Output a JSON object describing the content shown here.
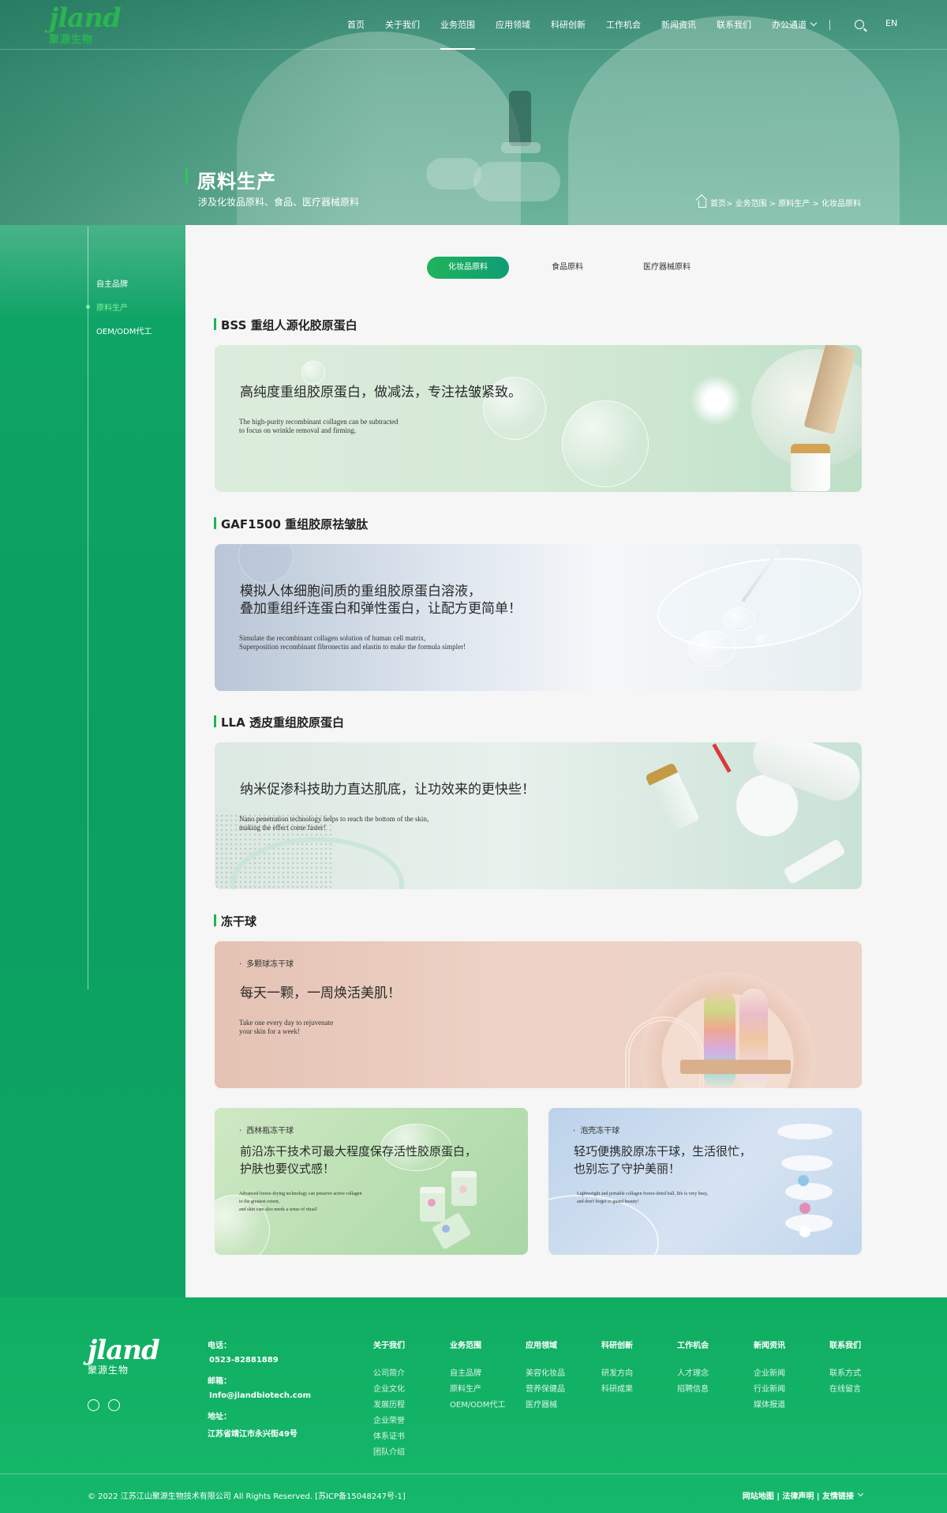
{
  "header": {
    "logo_word": "jland",
    "logo_cn": "聚源生物",
    "nav": [
      "首页",
      "关于我们",
      "业务范围",
      "应用领域",
      "科研创新",
      "工作机会",
      "新闻资讯",
      "联系我们",
      "办公通道"
    ],
    "active_nav": "业务范围",
    "lang": "EN"
  },
  "hero": {
    "title": "原料生产",
    "subtitle": "涉及化妆品原料、食品、医疗器械原料",
    "breadcrumb": "首页> 业务范围 > 原料生产 > 化妆品原料"
  },
  "sidebar": {
    "items": [
      "自主品牌",
      "原料生产",
      "OEM/ODM代工"
    ],
    "active": "原料生产"
  },
  "tabs": {
    "items": [
      "化妆品原料",
      "食品原料",
      "医疗器械原料"
    ],
    "active": "化妆品原料"
  },
  "sections": [
    {
      "heading": "BSS 重组人源化胶原蛋白",
      "banner_cn": [
        "高纯度重组胶原蛋白，做减法，专注祛皱紧致。"
      ],
      "banner_en": [
        "The high-purity recombinant collagen can be subtracted",
        "to focus on wrinkle removal and firming."
      ]
    },
    {
      "heading": "GAF1500 重组胶原祛皱肽",
      "banner_cn": [
        "模拟人体细胞间质的重组胶原蛋白溶液，",
        "叠加重组纤连蛋白和弹性蛋白，让配方更简单！"
      ],
      "banner_en": [
        "Simulate the recombinant collagen solution of human cell matrix,",
        "Superposition recombinant fibronectin and elastin to make the formula simpler!"
      ]
    },
    {
      "heading": "LLA 透皮重组胶原蛋白",
      "banner_cn": [
        "纳米促渗科技助力直达肌底，让功效来的更快些！"
      ],
      "banner_en": [
        "Nano penetration technology helps to reach the bottom of the skin,",
        "making the effect come faster!"
      ]
    },
    {
      "heading": "冻干球",
      "banners": [
        {
          "tag": "多颗球冻干球",
          "cn": [
            "每天一颗，一周焕活美肌！"
          ],
          "en": [
            "Take one every day to rejuvenate",
            "your skin for a week!"
          ]
        },
        {
          "tag": "西林瓶冻干球",
          "cn": [
            "前沿冻干技术可最大程度保存活性胶原蛋白，",
            "护肤也要仪式感！"
          ],
          "en": [
            "Advanced freeze-drying technology can preserve active collagen",
            "to the greatest extent,",
            "and skin care also needs a sense of ritual!"
          ]
        },
        {
          "tag": "泡壳冻干球",
          "cn": [
            "轻巧便携胶原冻干球，生活很忙，",
            "也别忘了守护美丽！"
          ],
          "en": [
            "Lightweight and portable collagen freeze-dried ball, life is very busy,",
            "and don't forget to guard beauty!"
          ]
        }
      ]
    }
  ],
  "footer": {
    "logo_word": "jland",
    "logo_cn": "聚源生物",
    "contact": {
      "phone_label": "电话：",
      "phone": "0523-82881889",
      "email_label": "邮箱：",
      "email": "Info@jlandbiotech.com",
      "address_label": "地址：",
      "address": "江苏省靖江市永兴街49号"
    },
    "columns": [
      {
        "title": "关于我们",
        "links": [
          "公司简介",
          "企业文化",
          "发展历程",
          "企业荣誉",
          "体系证书",
          "团队介绍"
        ]
      },
      {
        "title": "业务范围",
        "links": [
          "自主品牌",
          "原料生产",
          "OEM/ODM代工"
        ]
      },
      {
        "title": "应用领域",
        "links": [
          "美容化妆品",
          "营养保健品",
          "医疗器械"
        ]
      },
      {
        "title": "科研创新",
        "links": [
          "研发方向",
          "科研成果"
        ]
      },
      {
        "title": "工作机会",
        "links": [
          "人才理念",
          "招聘信息"
        ]
      },
      {
        "title": "新闻资讯",
        "links": [
          "企业新闻",
          "行业新闻",
          "媒体报道"
        ]
      },
      {
        "title": "联系我们",
        "links": [
          "联系方式",
          "在线留言"
        ]
      }
    ],
    "copyright": "© 2022 江苏江山聚源生物技术有限公司 All Rights Reserved. [苏ICP备15048247号-1]",
    "links": "网站地图 | 法律声明 | 友情链接"
  },
  "icons": {
    "search": "search-icon",
    "home": "home-icon",
    "wechat": "wechat-icon",
    "tiktok": "tiktok-icon",
    "chevron": "chevron-down-icon"
  },
  "colors": {
    "brand_green": "#1eb455",
    "sidebar_green": "#0fa567",
    "footer_green": "#12b266",
    "active_side": "#7ef29d"
  }
}
